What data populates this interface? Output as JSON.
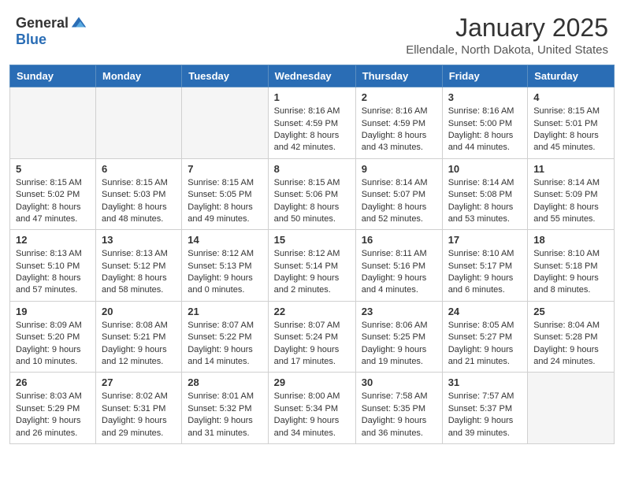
{
  "header": {
    "logo": {
      "general": "General",
      "blue": "Blue"
    },
    "title": "January 2025",
    "location": "Ellendale, North Dakota, United States"
  },
  "calendar": {
    "days_of_week": [
      "Sunday",
      "Monday",
      "Tuesday",
      "Wednesday",
      "Thursday",
      "Friday",
      "Saturday"
    ],
    "weeks": [
      [
        {
          "num": "",
          "empty": true
        },
        {
          "num": "",
          "empty": true
        },
        {
          "num": "",
          "empty": true
        },
        {
          "num": "1",
          "sunrise": "8:16 AM",
          "sunset": "4:59 PM",
          "daylight": "8 hours and 42 minutes."
        },
        {
          "num": "2",
          "sunrise": "8:16 AM",
          "sunset": "4:59 PM",
          "daylight": "8 hours and 43 minutes."
        },
        {
          "num": "3",
          "sunrise": "8:16 AM",
          "sunset": "5:00 PM",
          "daylight": "8 hours and 44 minutes."
        },
        {
          "num": "4",
          "sunrise": "8:15 AM",
          "sunset": "5:01 PM",
          "daylight": "8 hours and 45 minutes."
        }
      ],
      [
        {
          "num": "5",
          "sunrise": "8:15 AM",
          "sunset": "5:02 PM",
          "daylight": "8 hours and 47 minutes."
        },
        {
          "num": "6",
          "sunrise": "8:15 AM",
          "sunset": "5:03 PM",
          "daylight": "8 hours and 48 minutes."
        },
        {
          "num": "7",
          "sunrise": "8:15 AM",
          "sunset": "5:05 PM",
          "daylight": "8 hours and 49 minutes."
        },
        {
          "num": "8",
          "sunrise": "8:15 AM",
          "sunset": "5:06 PM",
          "daylight": "8 hours and 50 minutes."
        },
        {
          "num": "9",
          "sunrise": "8:14 AM",
          "sunset": "5:07 PM",
          "daylight": "8 hours and 52 minutes."
        },
        {
          "num": "10",
          "sunrise": "8:14 AM",
          "sunset": "5:08 PM",
          "daylight": "8 hours and 53 minutes."
        },
        {
          "num": "11",
          "sunrise": "8:14 AM",
          "sunset": "5:09 PM",
          "daylight": "8 hours and 55 minutes."
        }
      ],
      [
        {
          "num": "12",
          "sunrise": "8:13 AM",
          "sunset": "5:10 PM",
          "daylight": "8 hours and 57 minutes."
        },
        {
          "num": "13",
          "sunrise": "8:13 AM",
          "sunset": "5:12 PM",
          "daylight": "8 hours and 58 minutes."
        },
        {
          "num": "14",
          "sunrise": "8:12 AM",
          "sunset": "5:13 PM",
          "daylight": "9 hours and 0 minutes."
        },
        {
          "num": "15",
          "sunrise": "8:12 AM",
          "sunset": "5:14 PM",
          "daylight": "9 hours and 2 minutes."
        },
        {
          "num": "16",
          "sunrise": "8:11 AM",
          "sunset": "5:16 PM",
          "daylight": "9 hours and 4 minutes."
        },
        {
          "num": "17",
          "sunrise": "8:10 AM",
          "sunset": "5:17 PM",
          "daylight": "9 hours and 6 minutes."
        },
        {
          "num": "18",
          "sunrise": "8:10 AM",
          "sunset": "5:18 PM",
          "daylight": "9 hours and 8 minutes."
        }
      ],
      [
        {
          "num": "19",
          "sunrise": "8:09 AM",
          "sunset": "5:20 PM",
          "daylight": "9 hours and 10 minutes."
        },
        {
          "num": "20",
          "sunrise": "8:08 AM",
          "sunset": "5:21 PM",
          "daylight": "9 hours and 12 minutes."
        },
        {
          "num": "21",
          "sunrise": "8:07 AM",
          "sunset": "5:22 PM",
          "daylight": "9 hours and 14 minutes."
        },
        {
          "num": "22",
          "sunrise": "8:07 AM",
          "sunset": "5:24 PM",
          "daylight": "9 hours and 17 minutes."
        },
        {
          "num": "23",
          "sunrise": "8:06 AM",
          "sunset": "5:25 PM",
          "daylight": "9 hours and 19 minutes."
        },
        {
          "num": "24",
          "sunrise": "8:05 AM",
          "sunset": "5:27 PM",
          "daylight": "9 hours and 21 minutes."
        },
        {
          "num": "25",
          "sunrise": "8:04 AM",
          "sunset": "5:28 PM",
          "daylight": "9 hours and 24 minutes."
        }
      ],
      [
        {
          "num": "26",
          "sunrise": "8:03 AM",
          "sunset": "5:29 PM",
          "daylight": "9 hours and 26 minutes."
        },
        {
          "num": "27",
          "sunrise": "8:02 AM",
          "sunset": "5:31 PM",
          "daylight": "9 hours and 29 minutes."
        },
        {
          "num": "28",
          "sunrise": "8:01 AM",
          "sunset": "5:32 PM",
          "daylight": "9 hours and 31 minutes."
        },
        {
          "num": "29",
          "sunrise": "8:00 AM",
          "sunset": "5:34 PM",
          "daylight": "9 hours and 34 minutes."
        },
        {
          "num": "30",
          "sunrise": "7:58 AM",
          "sunset": "5:35 PM",
          "daylight": "9 hours and 36 minutes."
        },
        {
          "num": "31",
          "sunrise": "7:57 AM",
          "sunset": "5:37 PM",
          "daylight": "9 hours and 39 minutes."
        },
        {
          "num": "",
          "empty": true
        }
      ]
    ]
  }
}
